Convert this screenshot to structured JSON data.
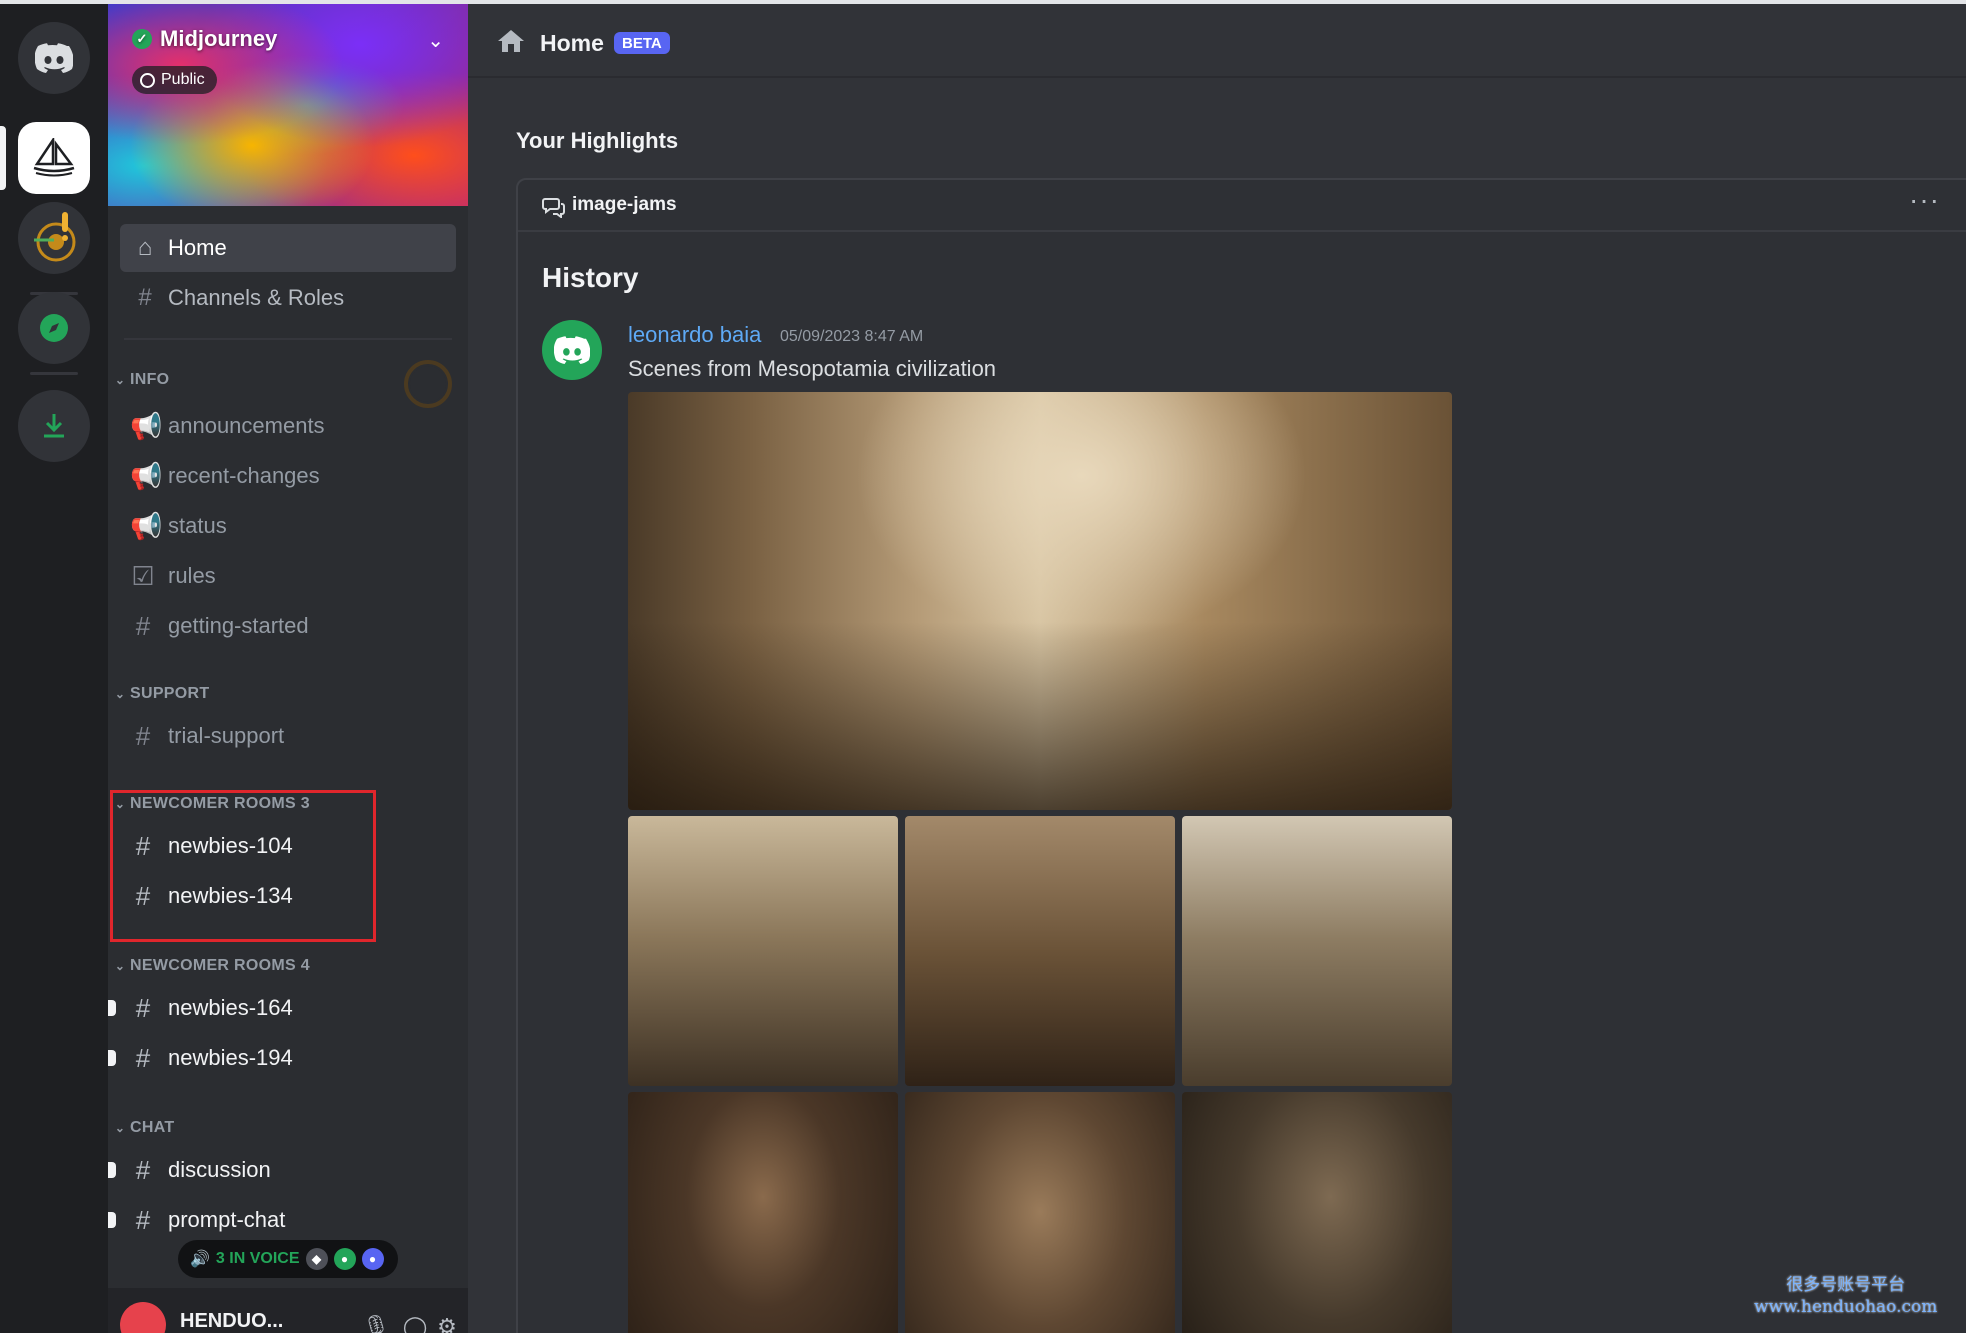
{
  "server": {
    "name": "Midjourney",
    "badge": "Public"
  },
  "nav": {
    "home": "Home",
    "channels_roles": "Channels & Roles"
  },
  "categories": [
    {
      "name": "INFO",
      "channels": [
        "announcements",
        "recent-changes",
        "status",
        "rules",
        "getting-started"
      ]
    },
    {
      "name": "SUPPORT",
      "channels": [
        "trial-support"
      ]
    },
    {
      "name": "NEWCOMER ROOMS 3",
      "channels": [
        "newbies-104",
        "newbies-134"
      ]
    },
    {
      "name": "NEWCOMER ROOMS 4",
      "channels": [
        "newbies-164",
        "newbies-194"
      ]
    },
    {
      "name": "CHAT",
      "channels": [
        "discussion",
        "prompt-chat"
      ]
    }
  ],
  "voice": {
    "label": "3 IN VOICE"
  },
  "user": {
    "name": "HENDUO..."
  },
  "header": {
    "title": "Home",
    "badge": "BETA"
  },
  "highlights": {
    "title": "Your Highlights",
    "thread": "image-jams",
    "section": "History",
    "message": {
      "author": "leonardo baia",
      "timestamp": "05/09/2023 8:47 AM",
      "text": "Scenes from Mesopotamia civilization"
    }
  },
  "watermark": {
    "line1": "很多号账号平台",
    "line2": "www.henduohao.com"
  },
  "colors": {
    "accent": "#5865f2",
    "green": "#23a559",
    "author": "#5ea9f5",
    "highlight_box": "#e0262c"
  }
}
